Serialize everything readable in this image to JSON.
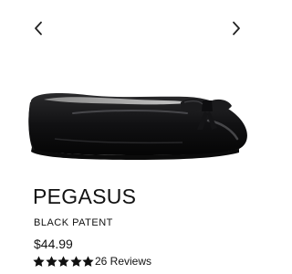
{
  "nav": {
    "prev_icon": "chevron-left-icon",
    "next_icon": "chevron-right-icon"
  },
  "product": {
    "name": "PEGASUS",
    "color": "BLACK PATENT",
    "price": "$44.99",
    "rating": {
      "stars": 5,
      "max": 5,
      "reviews": "26 Reviews"
    }
  },
  "colors": {
    "text": "#111111",
    "star": "#111111"
  }
}
